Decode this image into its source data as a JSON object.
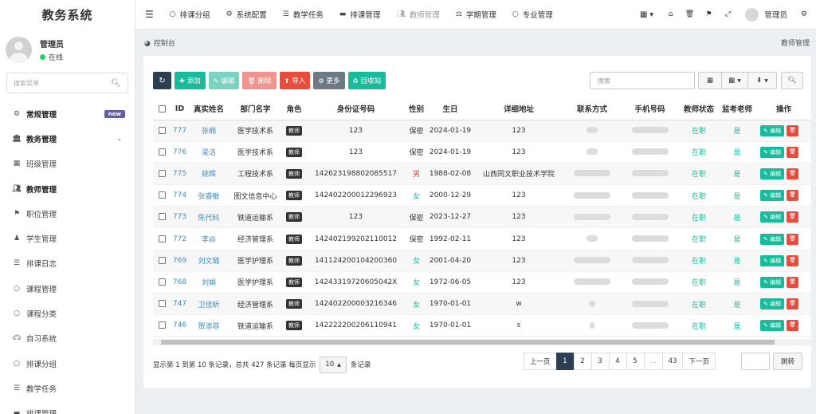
{
  "app": {
    "title": "教务系统"
  },
  "user": {
    "name": "管理员",
    "status": "在线"
  },
  "sidebar": {
    "search_placeholder": "搜索菜单",
    "items": [
      {
        "label": "常规管理",
        "icon": "cogs-icon",
        "badge": "new",
        "bold": true
      },
      {
        "label": "教务管理",
        "icon": "bank-icon",
        "bold": true,
        "expanded": true
      },
      {
        "label": "班级管理",
        "icon": "table-icon"
      },
      {
        "label": "教师管理",
        "icon": "users-icon",
        "active": true
      },
      {
        "label": "职位管理",
        "icon": "graduation-icon"
      },
      {
        "label": "学生管理",
        "icon": "student-icon"
      },
      {
        "label": "排课日志",
        "icon": "list-icon"
      },
      {
        "label": "课程管理",
        "icon": "circle-icon"
      },
      {
        "label": "课程分类",
        "icon": "circle-icon"
      },
      {
        "label": "自习系统",
        "icon": "car-icon"
      },
      {
        "label": "排课分组",
        "icon": "circle-icon"
      },
      {
        "label": "教学任务",
        "icon": "list-icon"
      },
      {
        "label": "排课管理",
        "icon": "folder-icon"
      }
    ]
  },
  "topnav": {
    "items": [
      {
        "label": "排课分组",
        "icon": "circle-icon"
      },
      {
        "label": "系统配置",
        "icon": "gear-icon"
      },
      {
        "label": "教学任务",
        "icon": "list-icon"
      },
      {
        "label": "排课管理",
        "icon": "folder-icon"
      },
      {
        "label": "教师管理",
        "icon": "users-icon",
        "muted": true
      },
      {
        "label": "学期管理",
        "icon": "scale-icon"
      },
      {
        "label": "专业管理",
        "icon": "circle-icon"
      }
    ],
    "user_label": "管理员"
  },
  "breadcrumb": {
    "home": "控制台",
    "current": "教师管理"
  },
  "toolbar": {
    "add": "添加",
    "edit": "编辑",
    "delete": "删除",
    "import": "导入",
    "more": "更多",
    "recycle": "回收站",
    "search_placeholder": "搜索"
  },
  "table": {
    "headers": [
      "ID",
      "真实姓名",
      "部门名字",
      "角色",
      "身份证号码",
      "性别",
      "生日",
      "详细地址",
      "联系方式",
      "手机号码",
      "教师状态",
      "监考老师",
      "操作"
    ],
    "role_tag": "教师",
    "edit_label": "编辑",
    "rows": [
      {
        "id": "777",
        "name": "张楠",
        "dept": "医学技术系",
        "idcard": "123",
        "gender": "保密",
        "g": "sec",
        "birth": "2024-01-19",
        "addr": "123",
        "status": "在职",
        "proctor": "是"
      },
      {
        "id": "776",
        "name": "梁洁",
        "dept": "医学技术系",
        "idcard": "123",
        "gender": "保密",
        "g": "sec",
        "birth": "2024-01-19",
        "addr": "123",
        "status": "在职",
        "proctor": "是"
      },
      {
        "id": "775",
        "name": "姚辉",
        "dept": "工程技术系",
        "idcard": "142623198802085517",
        "gender": "男",
        "g": "male",
        "birth": "1988-02-08",
        "addr": "山西同文职业技术学院",
        "status": "在职",
        "proctor": "是"
      },
      {
        "id": "774",
        "name": "张睿敏",
        "dept": "图文信息中心",
        "idcard": "142402200012296923",
        "gender": "女",
        "g": "female",
        "birth": "2000-12-29",
        "addr": "123",
        "status": "在职",
        "proctor": "是"
      },
      {
        "id": "773",
        "name": "陈代科",
        "dept": "铁道运输系",
        "idcard": "123",
        "gender": "保密",
        "g": "sec",
        "birth": "2023-12-27",
        "addr": "123",
        "status": "在职",
        "proctor": "是"
      },
      {
        "id": "772",
        "name": "李焱",
        "dept": "经济管理系",
        "idcard": "142402199202110012",
        "gender": "保密",
        "g": "sec",
        "birth": "1992-02-11",
        "addr": "123",
        "status": "在职",
        "proctor": "是"
      },
      {
        "id": "769",
        "name": "刘文璐",
        "dept": "医学护理系",
        "idcard": "141124200104200360",
        "gender": "女",
        "g": "female",
        "birth": "2001-04-20",
        "addr": "123",
        "status": "在职",
        "proctor": "是"
      },
      {
        "id": "768",
        "name": "刘娟",
        "dept": "医学护理系",
        "idcard": "14243319720605042X",
        "gender": "女",
        "g": "female",
        "birth": "1972-06-05",
        "addr": "123",
        "status": "在职",
        "proctor": "是"
      },
      {
        "id": "747",
        "name": "卫佳昕",
        "dept": "经济管理系",
        "idcard": "142402200003216346",
        "gender": "女",
        "g": "female",
        "birth": "1970-01-01",
        "addr": "w",
        "status": "在职",
        "proctor": "是"
      },
      {
        "id": "746",
        "name": "贺添菲",
        "dept": "铁道运输系",
        "idcard": "142222200206110941",
        "gender": "女",
        "g": "female",
        "birth": "1970-01-01",
        "addr": "s",
        "status": "在职",
        "proctor": "是"
      }
    ]
  },
  "pagination": {
    "info_prefix": "显示第 1 到第 10 条记录，总共 427 条记录 每页显示",
    "page_size": "10",
    "info_suffix": "条记录",
    "prev": "上一页",
    "pages": [
      "1",
      "2",
      "3",
      "4",
      "5",
      "...",
      "43"
    ],
    "current": "1",
    "next": "下一页",
    "jump": "跳转"
  },
  "colors": {
    "primary": "#18bc9c",
    "dark": "#2c3e50",
    "danger": "#e74c3c",
    "link": "#3c8dbc"
  }
}
